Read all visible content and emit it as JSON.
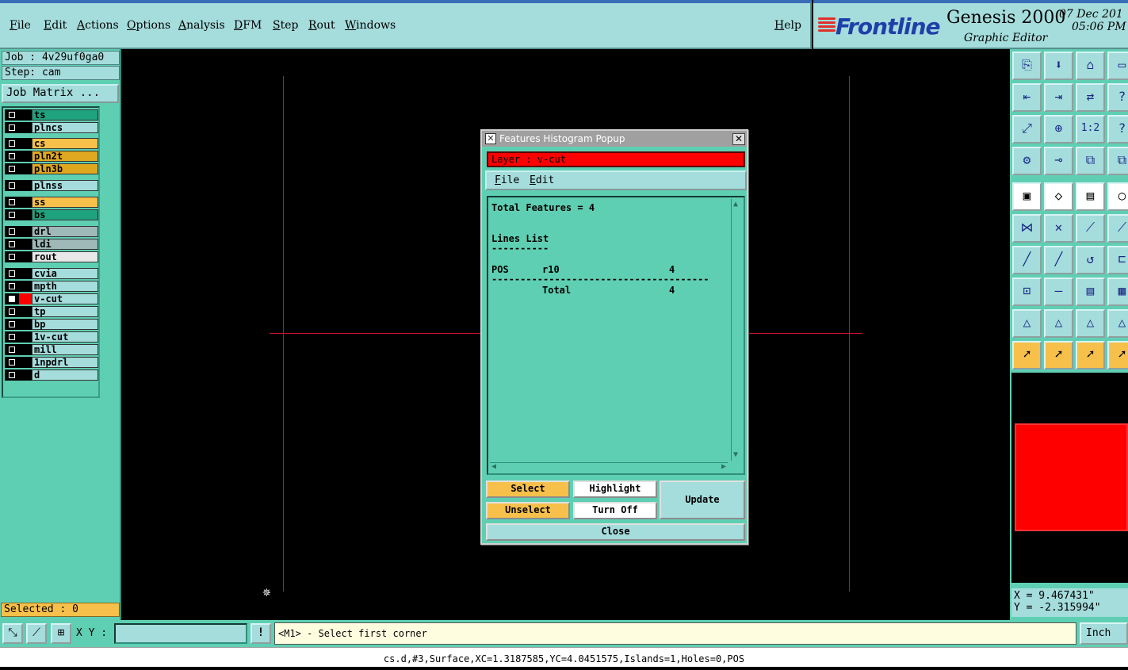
{
  "menubar": {
    "items": [
      "File",
      "Edit",
      "Actions",
      "Options",
      "Analysis",
      "DFM",
      "Step",
      "Rout",
      "Windows"
    ],
    "help": "Help"
  },
  "brand": {
    "logo": "Frontline",
    "product": "Genesis 2000",
    "subtitle": "Graphic Editor",
    "date": "07 Dec 201",
    "time": "05:06 PM"
  },
  "left": {
    "job": "Job : 4v29uf0ga0",
    "step": "Step: cam",
    "job_matrix": "Job Matrix ...",
    "selected": "Selected : 0",
    "layers": [
      {
        "name": "ts",
        "color": "#1fa27e"
      },
      {
        "name": "plncs",
        "color": "#a5dcdc"
      },
      {
        "name": "cs",
        "color": "#f7c04a"
      },
      {
        "name": "pln2t",
        "color": "#e0a820"
      },
      {
        "name": "pln3b",
        "color": "#e0a820"
      },
      {
        "name": "plnss",
        "color": "#a5dcdc"
      },
      {
        "name": "ss",
        "color": "#f7c04a"
      },
      {
        "name": "bs",
        "color": "#1fa27e"
      },
      {
        "name": "drl",
        "color": "#9fb8b8"
      },
      {
        "name": "ldi",
        "color": "#9fb8b8"
      },
      {
        "name": "rout",
        "color": "#e8e8e8"
      },
      {
        "name": "cvia",
        "color": "#a5dcdc"
      },
      {
        "name": "mpth",
        "color": "#a5dcdc"
      },
      {
        "name": "v-cut",
        "color": "#a5dcdc",
        "active": true
      },
      {
        "name": "tp",
        "color": "#a5dcdc"
      },
      {
        "name": "bp",
        "color": "#a5dcdc"
      },
      {
        "name": "1v-cut",
        "color": "#a5dcdc"
      },
      {
        "name": "mill",
        "color": "#a5dcdc"
      },
      {
        "name": "1npdrl",
        "color": "#a5dcdc"
      },
      {
        "name": "d",
        "color": "#a5dcdc"
      }
    ]
  },
  "popup": {
    "title": "Features Histogram Popup",
    "layer": "Layer :  v-cut",
    "menu": {
      "file": "File",
      "edit": "Edit"
    },
    "text": {
      "total": "Total Features = 4",
      "lines_list": "Lines List",
      "underline": "----------",
      "pos": "POS",
      "sym": "r10",
      "count": "4",
      "separator": "--------------------------------------",
      "total_label": "Total",
      "total_count": "4"
    },
    "buttons": {
      "select": "Select",
      "unselect": "Unselect",
      "highlight": "Highlight",
      "turn_off": "Turn Off",
      "update": "Update",
      "close": "Close"
    }
  },
  "right": {
    "tool_icons": [
      "clipboard-icon",
      "save-icon",
      "home-icon",
      "layout-icon",
      "import-icon",
      "export-icon",
      "swap-icon",
      "unknown-icon",
      "zoom-fit-icon",
      "zoom-in-icon",
      "one-to-two",
      "help-icon",
      "settings-icon",
      "probe-icon",
      "component-icon",
      "component-icon",
      "frame-icon",
      "shape-icon",
      "ruler-icon",
      "circle-icon",
      "net-icon",
      "cross-icon",
      "line-icon",
      "line-icon",
      "slash-icon",
      "slash-icon",
      "arc-icon",
      "edge-icon",
      "node-icon",
      "minus-icon",
      "ruler-icon",
      "chip-icon",
      "triangle-icon",
      "triangle-icon",
      "triangle-icon",
      "triangle-icon",
      "pointer-icon",
      "pointer-icon",
      "pointer-icon",
      "pointer-icon"
    ],
    "one_to_two": "1:2",
    "coords": {
      "x": "X = 9.467431\"",
      "y": "Y = -2.315994\""
    }
  },
  "bottom": {
    "xy_label": "X Y :",
    "prompt": "<M1> - Select first corner",
    "units": "Inch",
    "status": "cs.d,#3,Surface,XC=1.3187585,YC=4.0451575,Islands=1,Holes=0,POS"
  }
}
